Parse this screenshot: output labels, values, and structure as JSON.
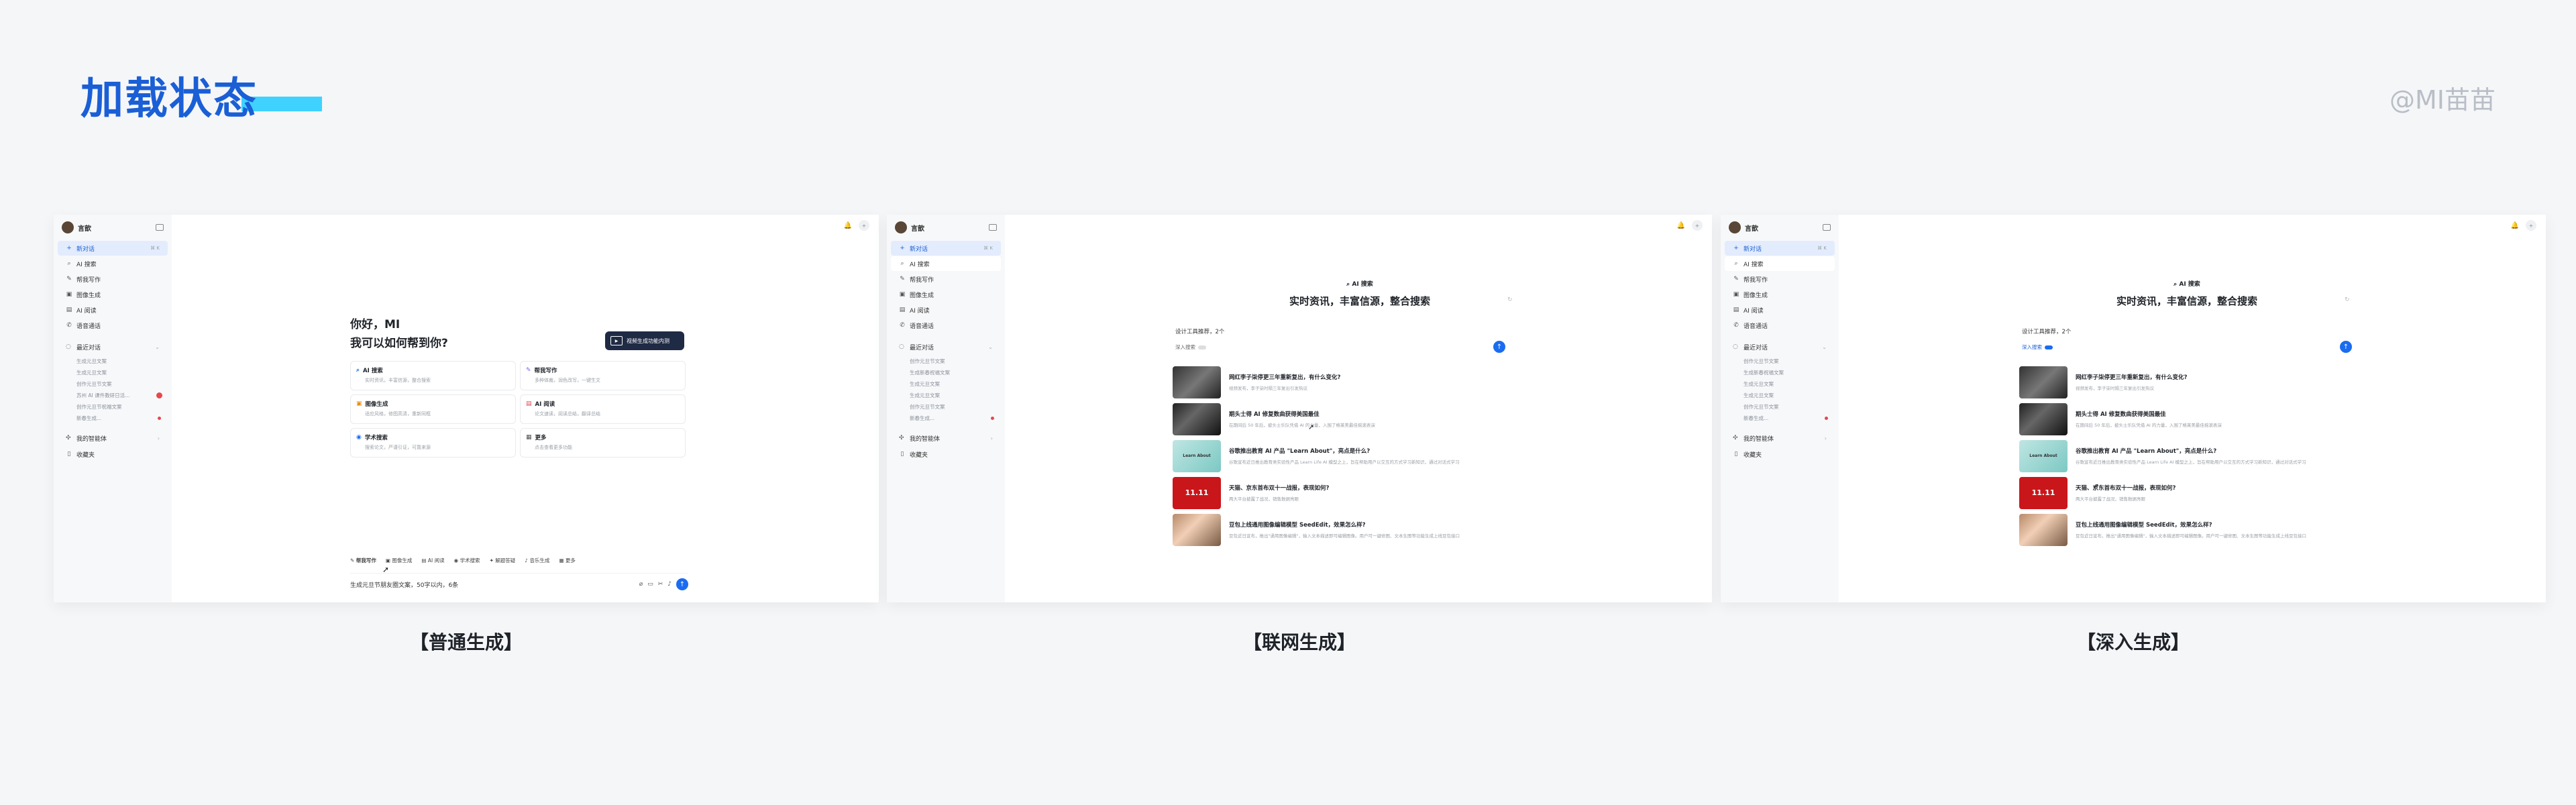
{
  "header": {
    "title": "加载状态",
    "watermark": "@MI苗苗"
  },
  "captions": [
    "【普通生成】",
    "【联网生成】",
    "【深入生成】"
  ],
  "colors": {
    "title": "#1a5fd6",
    "title_bar": "#3fd2ff",
    "accent": "#1a6cf0",
    "active_bg": "#e3ecfd"
  },
  "sidebar": {
    "user": "言歆",
    "new_chat": "新对话",
    "new_chat_shortcut": "⌘ K",
    "items": [
      "AI 搜索",
      "帮我写作",
      "图像生成",
      "AI 阅读",
      "语音通话"
    ],
    "recent_label": "最近对话",
    "recent": [
      "生成元旦文案",
      "生成元旦文案",
      "创作元旦节文案",
      "苏州 AI 课件教研日活...",
      "创作元旦节祝福文案",
      "新春生成..."
    ],
    "recent_alt": [
      "创作元旦节文案",
      "生成新春祝福文案",
      "生成元旦文案",
      "生成元旦文案",
      "创作元旦节文案",
      "新春生成..."
    ],
    "agents": "我的智能体",
    "favorites": "收藏夹"
  },
  "normal": {
    "greeting_1": "你好，MI",
    "greeting_2": "我可以如何帮到你?",
    "video_button": "视频生成功能内测",
    "cards": [
      {
        "icon": "search-icon",
        "glyph": "⌕",
        "color": "#1a6cf0",
        "title": "AI 搜索",
        "desc": "实时资讯，丰富信源，整合搜索"
      },
      {
        "icon": "pen-icon",
        "glyph": "✎",
        "color": "#7a5af8",
        "title": "帮我写作",
        "desc": "多种体裁，润色改写，一键生文"
      },
      {
        "icon": "image-icon",
        "glyph": "▣",
        "color": "#f08c00",
        "title": "图像生成",
        "desc": "适应风格，修图高清，重新同框"
      },
      {
        "icon": "read-icon",
        "glyph": "▤",
        "color": "#e5484d",
        "title": "AI 阅读",
        "desc": "论文速读，阅读总结，翻译总结"
      },
      {
        "icon": "study-icon",
        "glyph": "◉",
        "color": "#1a6cf0",
        "title": "学术搜索",
        "desc": "搜索论文，严谨引证，可靠来源"
      },
      {
        "icon": "more-icon",
        "glyph": "▦",
        "color": "#555555",
        "title": "更多",
        "desc": "点击查看更多功能"
      }
    ],
    "toolbar": [
      "帮我写作",
      "图像生成",
      "AI 阅读",
      "学术搜索",
      "解题答疑",
      "音乐生成",
      "更多"
    ],
    "input_value": "生成元旦节朋友圈文案，50字以内，6条"
  },
  "search": {
    "mode_label": "AI 搜索",
    "title": "实时资讯，丰富信源，整合搜索",
    "input_value": "设计工具推荐，2个",
    "toggle_label": "深入搜索",
    "news": [
      {
        "title": "网红李子柒停更三年重新复出，有什么变化?",
        "desc": "视频发布，李子柒时隔三年复出引发热议",
        "thumb": ""
      },
      {
        "title": "期头士得 AI 修复数曲获得美国最佳",
        "desc": "在期间后 50 年后，披头士乐队凭借 AI 的力量，入围了格莱美最佳摇滚表演",
        "thumb": ""
      },
      {
        "title": "谷歌推出教育 AI 产品 \"Learn About\"，亮点是什么?",
        "desc": "谷歌宣布近日推出教育类实验性产品 Learn Life AI 模型之上，旨在帮助用户以交互的方式学习新知识，通过对话式学习",
        "thumb": "Learn About"
      },
      {
        "title": "天猫、京东首布双十一战报，表现如何?",
        "desc": "两大平台披露了战况，销售数据亮眼",
        "thumb": "11.11"
      },
      {
        "title": "豆包上线通用图像编辑模型 SeedEdit，效果怎么样?",
        "desc": "豆包近日宣布，推出\"通用图像编辑\"，输入文本描述即可编辑图像。用户可一键修图、文本生图等功能生成上线豆包接口",
        "thumb": ""
      }
    ]
  }
}
